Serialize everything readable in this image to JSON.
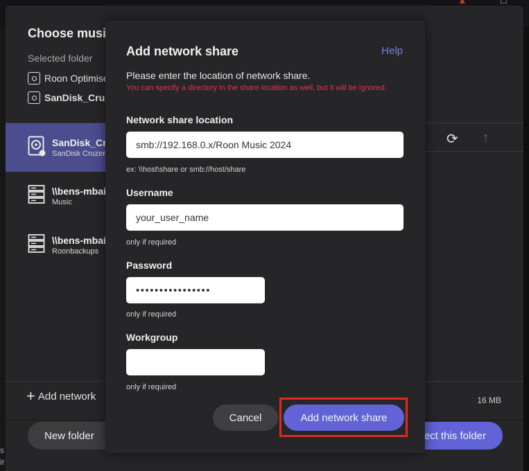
{
  "background": {
    "title": "Choose music folder",
    "selected_folder_label": "Selected folder",
    "path": [
      {
        "label": "Roon Optimised Core Kit",
        "icon": "core-device-icon"
      },
      {
        "label": "SanDisk_Cruzer",
        "icon": "drive-icon"
      }
    ],
    "list": [
      {
        "name": "SanDisk_Cruzer",
        "sub": "SanDisk Cruzer",
        "icon": "drive-icon",
        "active": true
      },
      {
        "name": "\\\\bens-mbair",
        "sub": "Music",
        "icon": "server-icon",
        "active": false
      },
      {
        "name": "\\\\bens-mbair",
        "sub": "Roonbackups",
        "icon": "server-icon",
        "active": false
      }
    ],
    "add_network_label": "Add network",
    "size_label": "16 MB",
    "new_folder_label": "New folder",
    "select_folder_label": "Select this folder",
    "left_edge_text": [
      "s",
      "ir"
    ]
  },
  "modal": {
    "title": "Add network share",
    "help_label": "Help",
    "description": "Please enter the location of network share.",
    "warning": "You can specify a directory in the share location as well, but it will be ignored.",
    "location": {
      "label": "Network share location",
      "value": "smb://192.168.0.x/Roon Music 2024",
      "hint": "ex: \\\\host\\share or smb://host/share"
    },
    "username": {
      "label": "Username",
      "value": "your_user_name",
      "hint": "only if required"
    },
    "password": {
      "label": "Password",
      "value": "••••••••••••••••",
      "hint": "only if required"
    },
    "workgroup": {
      "label": "Workgroup",
      "value": "",
      "hint": "only if required"
    },
    "cancel_label": "Cancel",
    "add_label": "Add network share"
  },
  "colors": {
    "accent": "#6163d6",
    "warning": "#e2334f",
    "highlight": "#e12a1f",
    "active_row": "#4c4d8f"
  }
}
